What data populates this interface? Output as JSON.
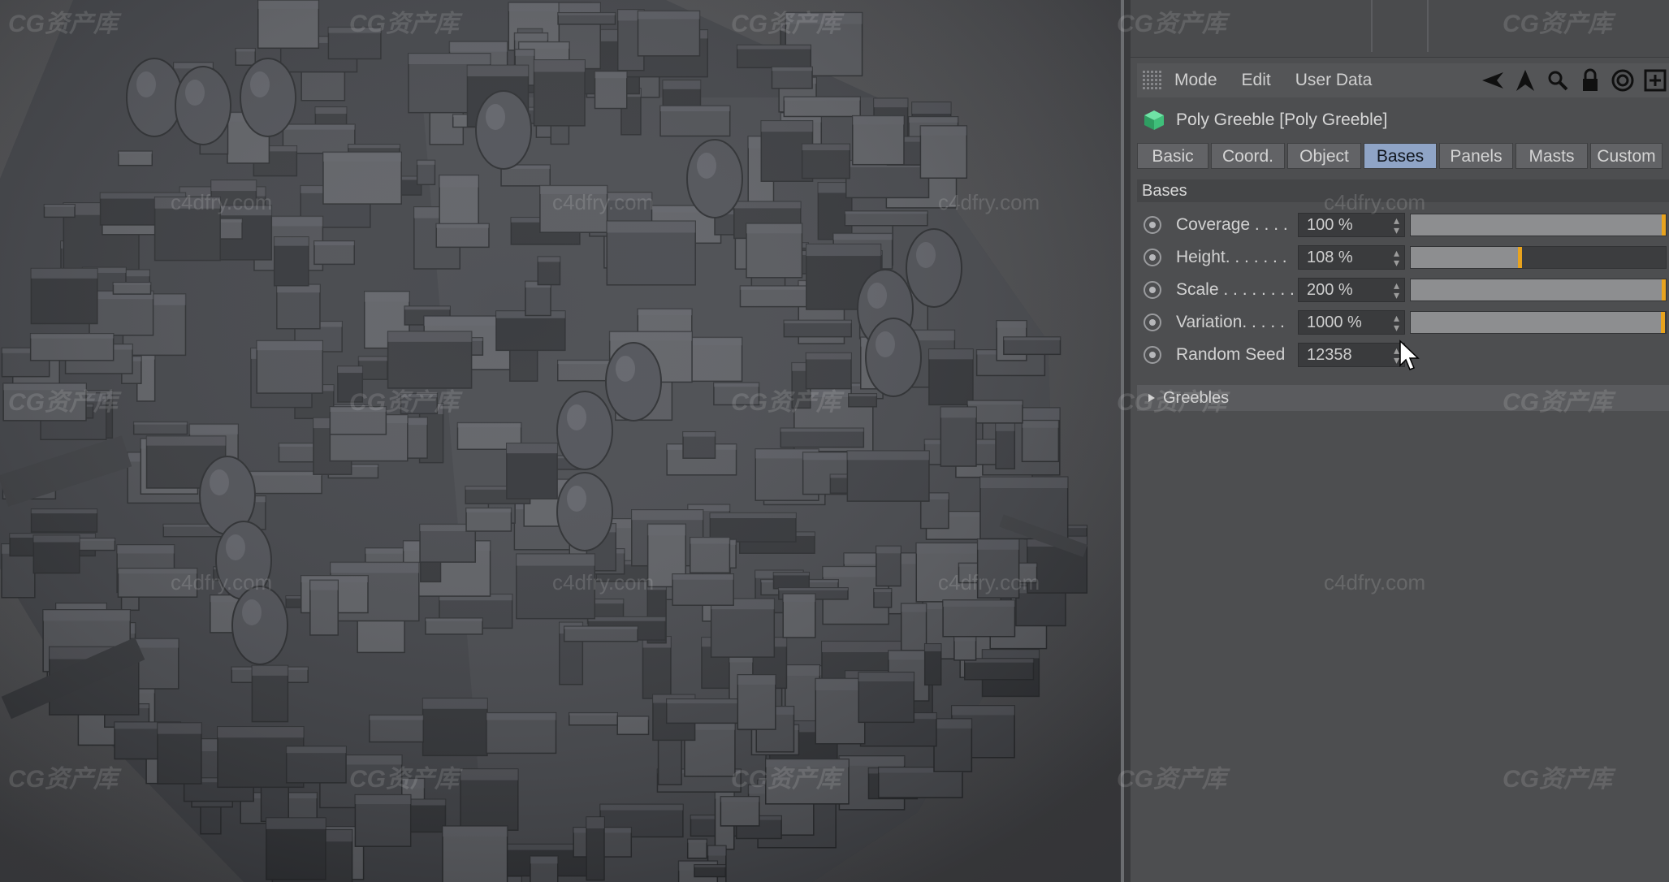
{
  "menu": {
    "items": [
      "Mode",
      "Edit",
      "User Data"
    ],
    "icons": [
      "arrow-left-icon",
      "arrow-up-icon",
      "search-icon",
      "lock-icon",
      "target-icon",
      "add-icon"
    ]
  },
  "object": {
    "title": "Poly Greeble [Poly Greeble]",
    "icon": "greeble-cube-icon",
    "icon_color": "#3fbf7a"
  },
  "tabs": [
    {
      "label": "Basic",
      "active": false
    },
    {
      "label": "Coord.",
      "active": false
    },
    {
      "label": "Object",
      "active": false
    },
    {
      "label": "Bases",
      "active": true
    },
    {
      "label": "Panels",
      "active": false
    },
    {
      "label": "Masts",
      "active": false
    },
    {
      "label": "Custom",
      "active": false
    }
  ],
  "section": {
    "title": "Bases"
  },
  "params": [
    {
      "label": "Coverage . . . .",
      "value": "100 %",
      "slider_fraction": 1.0
    },
    {
      "label": "Height. . . . . . .",
      "value": "108 %",
      "slider_fraction": 0.42
    },
    {
      "label": "Scale . . . . . . . .",
      "value": "200 %",
      "slider_fraction": 1.0
    },
    {
      "label": "Variation. . . . .",
      "value": "1000 %",
      "slider_fraction": 0.98
    },
    {
      "label": "Random Seed",
      "value": "12358",
      "slider_fraction": null
    }
  ],
  "greebles_group": {
    "label": "Greebles"
  },
  "accent_color": "#e8a31e",
  "watermarks": {
    "cg": "CG资产库",
    "site": "c4dfry.com"
  }
}
